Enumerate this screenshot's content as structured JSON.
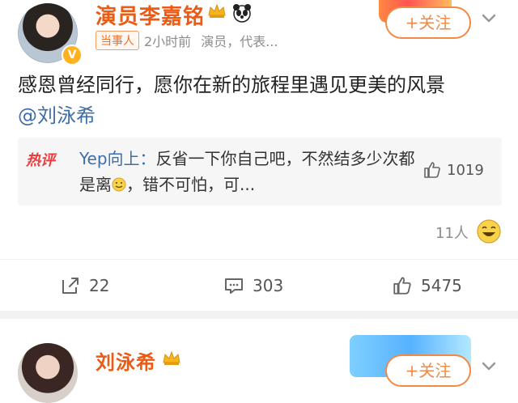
{
  "post": {
    "username": "演员李嘉铭",
    "badge": "V",
    "follow": "+关注",
    "meta": {
      "tag": "当事人",
      "time": "2小时前",
      "desc": "演员，代表..."
    },
    "content_line1": "感恩曾经同行，愿你在新的旅程里遇见更美的风景",
    "mention": "@刘泳希",
    "hot_comment": {
      "label": "热评",
      "user": "Yep向上：",
      "text": "反省一下你自己吧，不然结多少次都是离",
      "text2": "，错不可怕，可...",
      "likes": "1019"
    },
    "likers": "11人",
    "actions": {
      "forward": "22",
      "comment": "303",
      "like": "5475"
    }
  },
  "post2": {
    "username": "刘泳希",
    "follow": "+关注"
  },
  "colors": {
    "accent": "#f08a44",
    "username": "#ea5b16",
    "link": "#3d6ea8",
    "muted": "#8c8c8c"
  }
}
